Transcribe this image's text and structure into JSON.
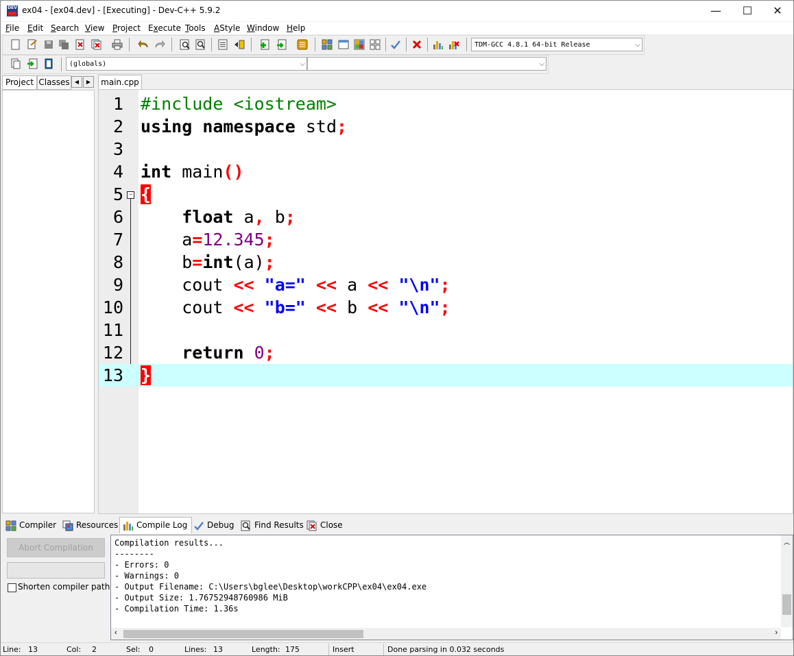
{
  "window": {
    "title": "ex04 - [ex04.dev] - [Executing] - Dev-C++ 5.9.2",
    "icon": "dev-cpp-icon",
    "controls": {
      "minimize": "—",
      "maximize": "☐",
      "close": "✕"
    }
  },
  "menu": [
    {
      "pre": "",
      "u": "F",
      "post": "ile"
    },
    {
      "pre": "",
      "u": "E",
      "post": "dit"
    },
    {
      "pre": "",
      "u": "S",
      "post": "earch"
    },
    {
      "pre": "",
      "u": "V",
      "post": "iew"
    },
    {
      "pre": "",
      "u": "P",
      "post": "roject"
    },
    {
      "pre": "E",
      "u": "x",
      "post": "ecute"
    },
    {
      "pre": "",
      "u": "T",
      "post": "ools"
    },
    {
      "pre": "",
      "u": "A",
      "post": "Style"
    },
    {
      "pre": "",
      "u": "W",
      "post": "indow"
    },
    {
      "pre": "",
      "u": "H",
      "post": "elp"
    }
  ],
  "toolbar": {
    "compiler_select": "TDM-GCC 4.8.1 64-bit Release",
    "scope_select": "(globals)",
    "member_select": ""
  },
  "left_panel": {
    "tabs": [
      "Project",
      "Classes"
    ],
    "scroll_left": "◀",
    "scroll_right": "▶"
  },
  "editor": {
    "tab": "main.cpp",
    "lines": [
      "1",
      "2",
      "3",
      "4",
      "5",
      "6",
      "7",
      "8",
      "9",
      "10",
      "11",
      "12",
      "13"
    ],
    "fold_minus": "−",
    "tokens": {
      "l1_pp": "#include <iostream>",
      "l2_kw1": "using",
      "l2_sp": " ",
      "l2_kw2": "namespace",
      "l2_id": " std",
      "semi": ";",
      "l4_kw": "int",
      "l4_id": " main",
      "l4_paren": "()",
      "open_brace": "{",
      "indent": "    ",
      "l6_kw": "float",
      "l6_a": " a",
      "comma": ",",
      "l6_b": " b",
      "l7_a": "a",
      "eq": "=",
      "l7_num": "12.345",
      "l8_b": "b",
      "l8_kw": "int",
      "lparen": "(",
      "l8_a": "a",
      "rparen": ")",
      "cout": "cout",
      "shl": " << ",
      "l9_str": "\"a=\"",
      "l9_var": "a",
      "nl_str": "\"\\n\"",
      "l10_str": "\"b=\"",
      "l10_var": "b",
      "l12_kw": "return",
      "l12_num": " 0",
      "close_brace": "}"
    }
  },
  "bottom_tabs": [
    "Compiler",
    "Resources",
    "Compile Log",
    "Debug",
    "Find Results",
    "Close"
  ],
  "compile_panel": {
    "abort_button": "Abort Compilation",
    "shorten_paths_label": "Shorten compiler paths",
    "log_lines": [
      "Compilation results...",
      "--------",
      "- Errors: 0",
      "- Warnings: 0",
      "- Output Filename: C:\\Users\\bglee\\Desktop\\workCPP\\ex04\\ex04.exe",
      "- Output Size: 1.76752948760986 MiB",
      "- Compilation Time: 1.36s"
    ]
  },
  "status": {
    "line_label": "Line:",
    "line_value": "13",
    "col_label": "Col:",
    "col_value": "2",
    "sel_label": "Sel:",
    "sel_value": "0",
    "lines_label": "Lines:",
    "lines_value": "13",
    "length_label": "Length:",
    "length_value": "175",
    "mode": "Insert",
    "message": "Done parsing in 0.032 seconds"
  },
  "colors": {
    "keyword": "#000000",
    "preprocessor": "#008000",
    "symbol": "#ff0000",
    "number": "#800080",
    "string": "#0000ff",
    "active_line": "#ccffff",
    "brace_highlight": "#ff0000"
  }
}
